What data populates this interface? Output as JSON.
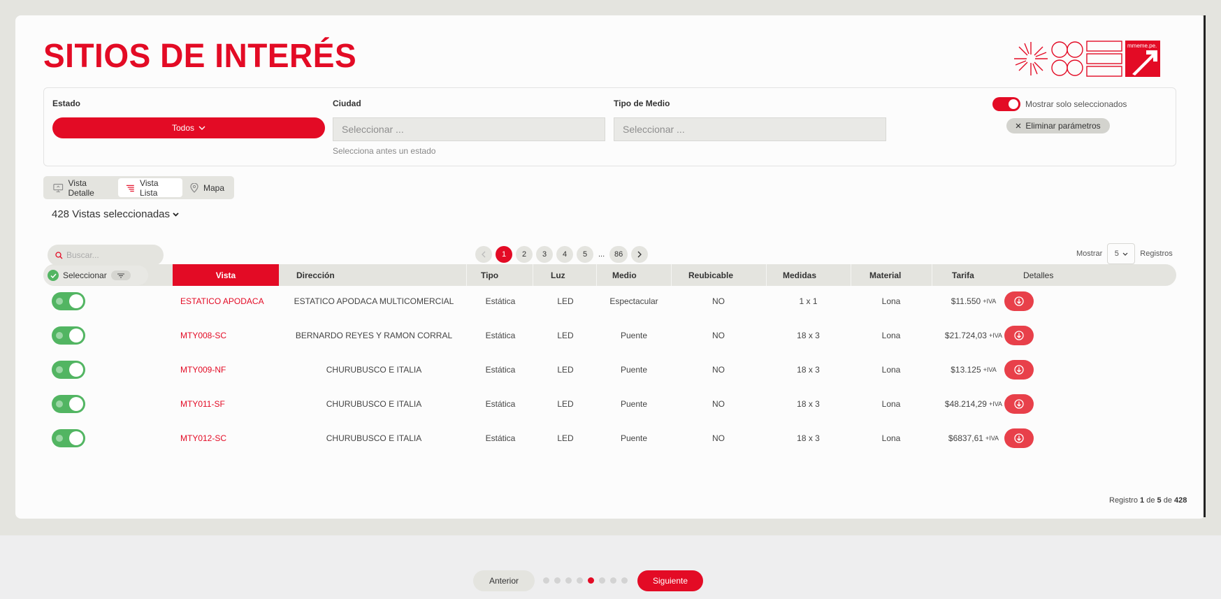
{
  "page": {
    "title": "SITIOS DE INTERÉS",
    "logo_text": "mmeme.pe."
  },
  "filters": {
    "estado": {
      "label": "Estado",
      "value": "Todos"
    },
    "ciudad": {
      "label": "Ciudad",
      "placeholder": "Seleccionar ...",
      "hint": "Selecciona antes un estado"
    },
    "tipo_medio": {
      "label": "Tipo de Medio",
      "placeholder": "Seleccionar ..."
    },
    "show_selected": {
      "label": "Mostrar solo seleccionados",
      "on": true
    },
    "clear_label": "Eliminar parámetros"
  },
  "view_tabs": [
    {
      "label": "Vista Detalle",
      "icon": "monitor-icon",
      "active": false
    },
    {
      "label": "Vista Lista",
      "icon": "list-icon",
      "active": true
    },
    {
      "label": "Mapa",
      "icon": "map-pin-icon",
      "active": false
    }
  ],
  "selection": {
    "summary": "428 Vistas seleccionadas"
  },
  "search": {
    "placeholder": "Buscar..."
  },
  "pagination": {
    "pages": [
      "1",
      "2",
      "3",
      "4",
      "5"
    ],
    "ellipsis": "...",
    "last": "86",
    "current": "1"
  },
  "page_size": {
    "prefix": "Mostrar",
    "value": "5",
    "suffix": "Registros"
  },
  "table": {
    "select_header": "Seleccionar",
    "columns": [
      "Vista",
      "Dirección",
      "Tipo",
      "Luz",
      "Medio",
      "Reubicable",
      "Medidas",
      "Material",
      "Tarifa",
      "Detalles"
    ],
    "iva_label": "+IVA",
    "rows": [
      {
        "vista": "ESTATICO APODACA",
        "direccion": "ESTATICO APODACA MULTICOMERCIAL",
        "tipo": "Estática",
        "luz": "LED",
        "medio": "Espectacular",
        "reubicable": "NO",
        "medidas": "1 x 1",
        "material": "Lona",
        "tarifa": "$11.550"
      },
      {
        "vista": "MTY008-SC",
        "direccion": "BERNARDO REYES Y RAMON CORRAL",
        "tipo": "Estática",
        "luz": "LED",
        "medio": "Puente",
        "reubicable": "NO",
        "medidas": "18 x 3",
        "material": "Lona",
        "tarifa": "$21.724,03"
      },
      {
        "vista": "MTY009-NF",
        "direccion": "CHURUBUSCO E ITALIA",
        "tipo": "Estática",
        "luz": "LED",
        "medio": "Puente",
        "reubicable": "NO",
        "medidas": "18 x 3",
        "material": "Lona",
        "tarifa": "$13.125"
      },
      {
        "vista": "MTY011-SF",
        "direccion": "CHURUBUSCO E ITALIA",
        "tipo": "Estática",
        "luz": "LED",
        "medio": "Puente",
        "reubicable": "NO",
        "medidas": "18 x 3",
        "material": "Lona",
        "tarifa": "$48.214,29"
      },
      {
        "vista": "MTY012-SC",
        "direccion": "CHURUBUSCO E ITALIA",
        "tipo": "Estática",
        "luz": "LED",
        "medio": "Puente",
        "reubicable": "NO",
        "medidas": "18 x 3",
        "material": "Lona",
        "tarifa": "$6837,61"
      }
    ]
  },
  "records": {
    "prefix": "Registro",
    "from": "1",
    "de1": "de",
    "to": "5",
    "de2": "de",
    "total": "428"
  },
  "wizard": {
    "prev": "Anterior",
    "next": "Siguiente",
    "steps": 8,
    "current_step": 5
  },
  "colors": {
    "accent": "#e30b25",
    "toggle_green": "#52b562",
    "panel": "#e4e4df"
  }
}
